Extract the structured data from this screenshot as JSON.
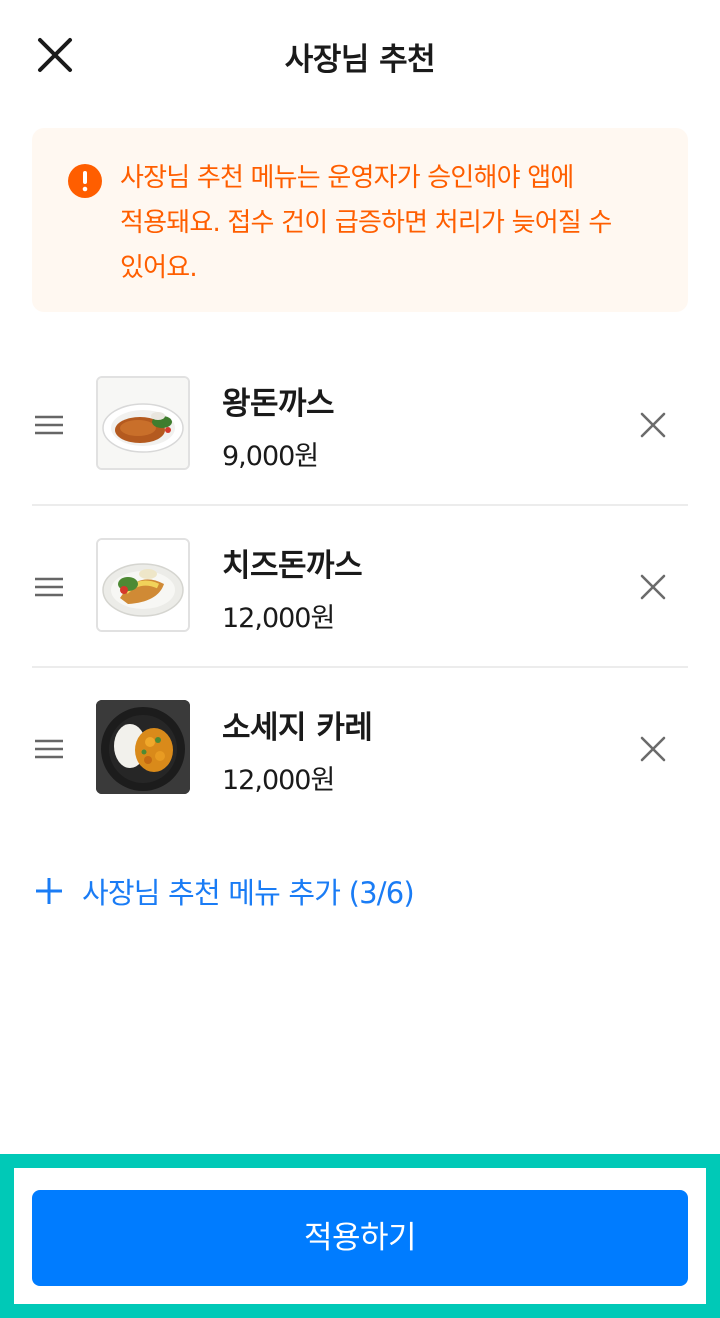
{
  "header": {
    "title": "사장님 추천",
    "close_icon": "close-icon"
  },
  "notice": {
    "icon": "warning-icon",
    "color": "#ff5e00",
    "background": "#fff8f1",
    "text": "사장님 추천 메뉴는 운영자가 승인해야 앱에 적용돼요. 접수 건이 급증하면 처리가 늦어질 수 있어요."
  },
  "menu_items": [
    {
      "name": "왕돈까스",
      "price": "9,000원",
      "image": "pork-cutlet-photo"
    },
    {
      "name": "치즈돈까스",
      "price": "12,000원",
      "image": "cheese-cutlet-photo"
    },
    {
      "name": "소세지 카레",
      "price": "12,000원",
      "image": "sausage-curry-photo"
    }
  ],
  "add_menu": {
    "label": "사장님 추천 메뉴 추가 (3/6)",
    "icon": "plus-icon",
    "color": "#1a7cf5"
  },
  "footer": {
    "apply_label": "적용하기",
    "button_color": "#007cff",
    "highlight_color": "#00c9b7"
  }
}
